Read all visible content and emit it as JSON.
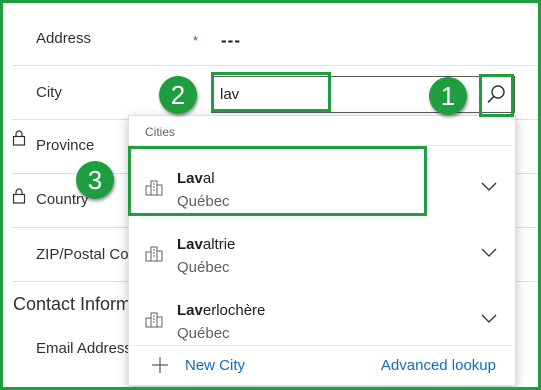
{
  "form": {
    "address": {
      "label": "Address",
      "required_mark": "*",
      "value": "---"
    },
    "city": {
      "label": "City",
      "input_value": "lav"
    },
    "province": {
      "label": "Province"
    },
    "country": {
      "label": "Country"
    },
    "zip": {
      "label": "ZIP/Postal Co"
    },
    "contact_section": {
      "title": "Contact Inform"
    },
    "email": {
      "label": "Email Address"
    }
  },
  "lookup": {
    "header": "Cities",
    "query": "Lav",
    "results": [
      {
        "match": "Lav",
        "rest": "al",
        "region": "Québec"
      },
      {
        "match": "Lav",
        "rest": "altrie",
        "region": "Québec"
      },
      {
        "match": "Lav",
        "rest": "erlochère",
        "region": "Québec"
      }
    ],
    "footer": {
      "new_label": "New City",
      "advanced_label": "Advanced lookup"
    }
  },
  "annotations": {
    "badge1": "1",
    "badge2": "2",
    "badge3": "3"
  },
  "colors": {
    "accent": "#1e9e3e",
    "link": "#0f6cbd",
    "required": "#a4262c"
  },
  "icons": [
    "lock-icon",
    "search-icon",
    "building-icon",
    "chevron-down-icon",
    "plus-icon"
  ]
}
